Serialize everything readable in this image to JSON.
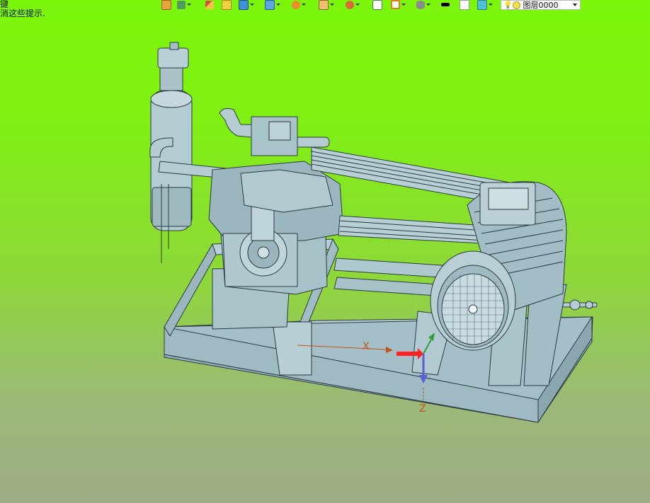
{
  "hint_lines": [
    "键",
    "消这些提示."
  ],
  "toolbar": {
    "icons": [
      "import-icon",
      "layer-stack-icon",
      "pencil-icon",
      "solid-block-icon",
      "cube-icon",
      "box-view-icon",
      "render-wheel-icon",
      "picture-frame-icon",
      "move-axis-icon",
      "page-icon",
      "section-icon",
      "display-mode-icon",
      "black-color-icon",
      "white-color-icon",
      "layers-icon"
    ],
    "layer_select": {
      "value": "图层0000",
      "bulb_icon": "lightbulb-icon",
      "state_icon": "sun-icon"
    }
  },
  "viewport": {
    "background_top": "#7cf70b",
    "background_bottom": "#9fad86",
    "model_color": "#a8c4cc",
    "outline_color": "#2c3a40"
  },
  "axis_triad": {
    "x_label": "X",
    "z_label": "Z"
  }
}
